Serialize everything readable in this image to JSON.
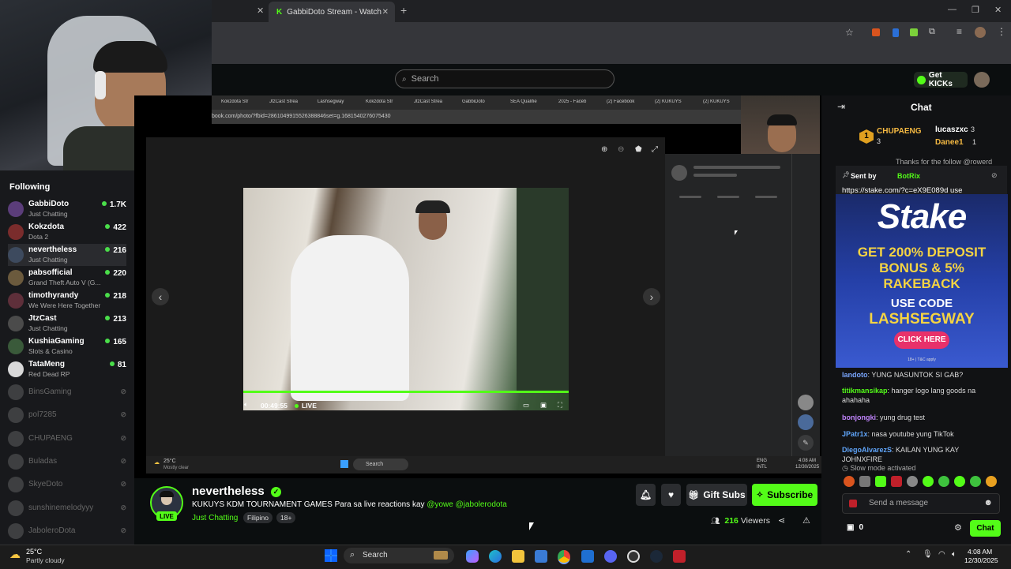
{
  "browser": {
    "tabs": [
      {
        "label": "GabbiDoto Stream - Watch Live"
      }
    ],
    "new_tab": "+"
  },
  "header": {
    "search_placeholder": "Search",
    "get_kicks_label": "Get KICKs"
  },
  "sidebar": {
    "heading": "Following",
    "online": [
      {
        "name": "GabbiDoto",
        "category": "Just Chatting",
        "viewers": "1.7K",
        "color": "#5b3d7a"
      },
      {
        "name": "Kokzdota",
        "category": "Dota 2",
        "viewers": "422",
        "color": "#7a2c2c"
      },
      {
        "name": "nevertheless",
        "category": "Just Chatting",
        "viewers": "216",
        "color": "#3d4a5e"
      },
      {
        "name": "pabsofficial",
        "category": "Grand Theft Auto V (G...",
        "viewers": "220",
        "color": "#6b5a3d"
      },
      {
        "name": "timothyrandy",
        "category": "We Were Here Together",
        "viewers": "218",
        "color": "#5e2f3a"
      },
      {
        "name": "JtzCast",
        "category": "Just Chatting",
        "viewers": "213",
        "color": "#4b4b4b"
      },
      {
        "name": "KushiaGaming",
        "category": "Slots & Casino",
        "viewers": "165",
        "color": "#3a5a3a"
      },
      {
        "name": "TataMeng",
        "category": "Red Dead RP",
        "viewers": "81",
        "color": "#d9d9d9"
      }
    ],
    "offline": [
      {
        "name": "BinsGaming"
      },
      {
        "name": "pol7285"
      },
      {
        "name": "CHUPAENG"
      },
      {
        "name": "Buladas"
      },
      {
        "name": "SkyeDoto"
      },
      {
        "name": "sunshinemelodyyy"
      },
      {
        "name": "JaboleroDota"
      }
    ]
  },
  "stream": {
    "inner_url": "book.com/photo/?fbid=2861049915526388846set=g.1681540276075430",
    "inner_tabs": [
      "Kokzdota Str",
      "JtzCast Strea",
      "Lashsegway",
      "Kokzdota Str",
      "JtzCast Strea",
      "GabbiDoto",
      "SEA Qualifie",
      "2025 - Faceb",
      "(2) Facebook",
      "(2) KUKUYS",
      "(2) KUKUYS"
    ],
    "player_time": "00:49:55",
    "player_live": "LIVE",
    "inner_weather_temp": "25°C",
    "inner_weather_desc": "Mostly clear",
    "inner_search": "Search",
    "inner_time": "4:08 AM",
    "inner_date": "12/30/2025",
    "inner_lang": "ENG",
    "inner_lang2": "INTL",
    "progress_fraction": 1.0
  },
  "channel": {
    "name": "nevertheless",
    "live_badge": "LIVE",
    "title_prefix": "KUKUYS KDM TOURNAMENT GAMES Para sa live reactions kay ",
    "title_mentions": "@yowe @jabolerodota",
    "category": "Just Chatting",
    "tags": [
      "Filipino",
      "18+"
    ],
    "viewers": "216",
    "viewers_label": "Viewers",
    "gift_subs_label": "Gift Subs",
    "subscribe_label": "Subscribe"
  },
  "chat": {
    "title": "Chat",
    "leaderboard": [
      {
        "rank": "1",
        "name": "CHUPAENG",
        "count": "3"
      },
      {
        "name": "lucaszxc",
        "count": "3"
      },
      {
        "name": "Danee1",
        "count": "1"
      }
    ],
    "pinned_top_line": "Thanks for the follow @rowerd",
    "sent_by_label": "Sent by",
    "sent_by_user": "BotRix",
    "pinned_link": "https://stake.com/?c=eX9E089d use",
    "ad": {
      "brand": "Stake",
      "line1": "GET 200% DEPOSIT",
      "line2": "BONUS & 5%",
      "line3": "RAKEBACK",
      "use_code": "USE CODE",
      "code": "LASHSEGWAY",
      "cta": "CLICK HERE",
      "fine": "18+ | T&C apply"
    },
    "messages": [
      {
        "user": "landoto",
        "text": "YUNG NASUNTOK SI GAB?",
        "color": "#7aa7ff"
      },
      {
        "user": "titikmansikap",
        "text": "hanger logo lang goods na ahahaha",
        "color": "#53fc18"
      },
      {
        "user": "bonjongki",
        "text": "yung drug test",
        "color": "#c084fc"
      },
      {
        "user": "JPatr1x",
        "text": "nasa youtube yung TikTok",
        "color": "#60a5fa"
      },
      {
        "user": "DiegoAlvarezS",
        "text": "KAILAN YUNG KAY JOHNXFIRE",
        "color": "#60a5fa"
      }
    ],
    "slow_mode": "Slow mode activated",
    "input_placeholder": "Send a message",
    "points": "0",
    "chat_button": "Chat"
  },
  "taskbar": {
    "weather_temp": "25°C",
    "weather_desc": "Partly cloudy",
    "search": "Search",
    "time": "4:08 AM",
    "date": "12/30/2025"
  }
}
